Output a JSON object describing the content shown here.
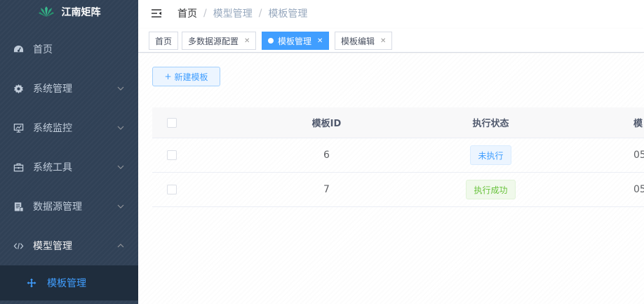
{
  "app": {
    "title": "江南矩阵"
  },
  "sidebar": {
    "items": [
      {
        "label": "首页",
        "icon": "dashboard-icon",
        "has_children": false
      },
      {
        "label": "系统管理",
        "icon": "gear-icon",
        "has_children": true
      },
      {
        "label": "系统监控",
        "icon": "monitor-icon",
        "has_children": true
      },
      {
        "label": "系统工具",
        "icon": "toolbox-icon",
        "has_children": true
      },
      {
        "label": "数据源管理",
        "icon": "database-icon",
        "has_children": true
      },
      {
        "label": "模型管理",
        "icon": "code-icon",
        "has_children": true,
        "expanded": true
      }
    ],
    "sub_items": [
      {
        "label": "模板管理",
        "icon": "move-icon",
        "active": true
      }
    ]
  },
  "breadcrumb": [
    "首页",
    "模型管理",
    "模板管理"
  ],
  "tags": [
    {
      "label": "首页",
      "closable": false,
      "active": false
    },
    {
      "label": "多数据源配置",
      "closable": true,
      "active": false
    },
    {
      "label": "模板管理",
      "closable": true,
      "active": true
    },
    {
      "label": "模板编辑",
      "closable": true,
      "active": false
    }
  ],
  "toolbar": {
    "new_label": "新建模板"
  },
  "table": {
    "columns": [
      "模板ID",
      "执行状态",
      "模"
    ],
    "rows": [
      {
        "id": "6",
        "status": "未执行",
        "status_type": "info",
        "partial": "05"
      },
      {
        "id": "7",
        "status": "执行成功",
        "status_type": "success",
        "partial": "05"
      }
    ]
  },
  "colors": {
    "sidebar_bg": "#304156",
    "sidebar_text": "#bfcbd9",
    "accent": "#409eff",
    "success": "#67c23a"
  }
}
